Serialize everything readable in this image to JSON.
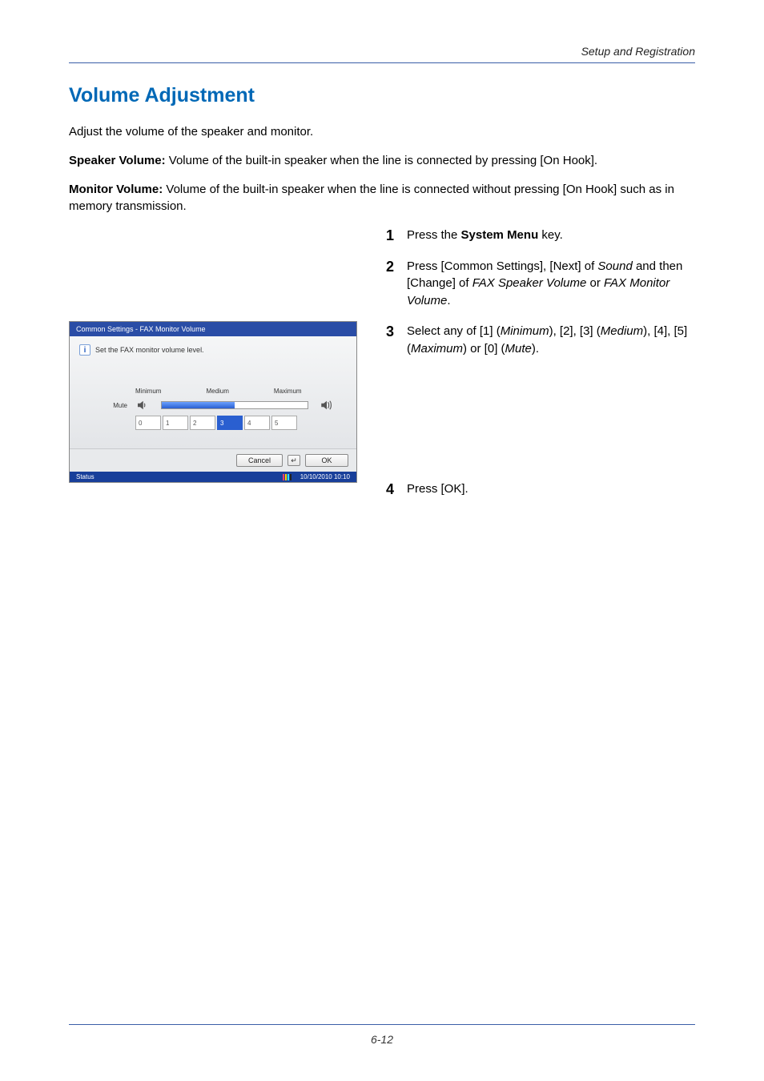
{
  "running_head": "Setup and Registration",
  "title": "Volume Adjustment",
  "intro": "Adjust the volume of the speaker and monitor.",
  "speaker_b": "Speaker Volume:",
  "speaker_t": " Volume of the built-in speaker when the line is connected by pressing [On Hook].",
  "monitor_b": "Monitor Volume:",
  "monitor_t": " Volume of the built-in speaker when the line is connected without pressing [On Hook] such as in memory transmission.",
  "steps": {
    "s1": {
      "num": "1",
      "pre": "Press the ",
      "b": "System Menu",
      "post": " key."
    },
    "s2": {
      "num": "2",
      "t1": "Press [Common Settings], [Next] of ",
      "i1": "Sound",
      "t2": " and then [Change] of ",
      "i2": "FAX Speaker Volume",
      "t3": " or ",
      "i3": "FAX Monitor Volume",
      "t4": "."
    },
    "s3": {
      "num": "3",
      "t1": "Select any of [1] (",
      "i1": "Minimum",
      "t2": "), [2], [3] (",
      "i2": "Medium",
      "t3": "), [4], [5]  (",
      "i3": "Maximum",
      "t4": ") or [0] (",
      "i4": "Mute",
      "t5": ")."
    },
    "s4": {
      "num": "4",
      "text": "Press [OK]."
    }
  },
  "mock": {
    "titlebar": "Common Settings - FAX Monitor Volume",
    "info_glyph": "i",
    "info_text": "Set the FAX monitor volume level.",
    "labels": {
      "minimum": "Minimum",
      "medium": "Medium",
      "maximum": "Maximum",
      "mute": "Mute"
    },
    "nums": [
      "0",
      "1",
      "2",
      "3",
      "4",
      "5"
    ],
    "selected_index": 3,
    "buttons": {
      "cancel": "Cancel",
      "enter": "↵",
      "ok": "OK"
    },
    "status": {
      "label": "Status",
      "datetime": "10/10/2010  10:10"
    }
  },
  "page_number": "6-12"
}
